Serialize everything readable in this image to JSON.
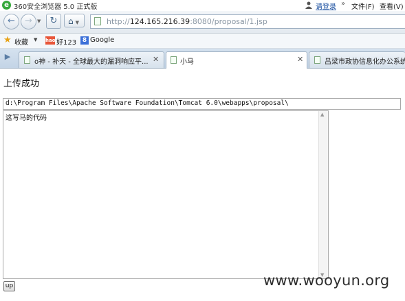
{
  "window": {
    "app_title": "360安全浏览器 5.0 正式版",
    "login_label": "请登录",
    "more_chevron": "»",
    "menu_file": "文件(F)",
    "menu_view": "查看(V)"
  },
  "toolbar": {
    "url_prefix": "http://",
    "url_host": "124.165.216.39",
    "url_path": ":8080/proposal/1.jsp"
  },
  "bookmarks": {
    "favorites_label": "收藏",
    "hao123_badge": "hao",
    "hao123_label": "好123",
    "google_badge": "8",
    "google_label": "Google"
  },
  "tabs": [
    {
      "label": "o神 - 补天 - 全球最大的漏洞响应平...",
      "active": false
    },
    {
      "label": "小马",
      "active": true
    },
    {
      "label": "吕梁市政协信息化办公系统",
      "active": false
    }
  ],
  "page": {
    "heading": "上传成功",
    "path_value": "d:\\Program Files\\Apache Software Foundation\\Tomcat 6.0\\webapps\\proposal\\",
    "code_value": "这写马的代码",
    "up_button_label": "up",
    "watermark": "www.wooyun.org"
  },
  "icons": [
    "app-logo-icon",
    "user-icon",
    "back-arrow-icon",
    "forward-arrow-icon",
    "refresh-icon",
    "home-icon",
    "page-icon",
    "star-icon",
    "sidebar-toggle-icon",
    "close-icon"
  ]
}
